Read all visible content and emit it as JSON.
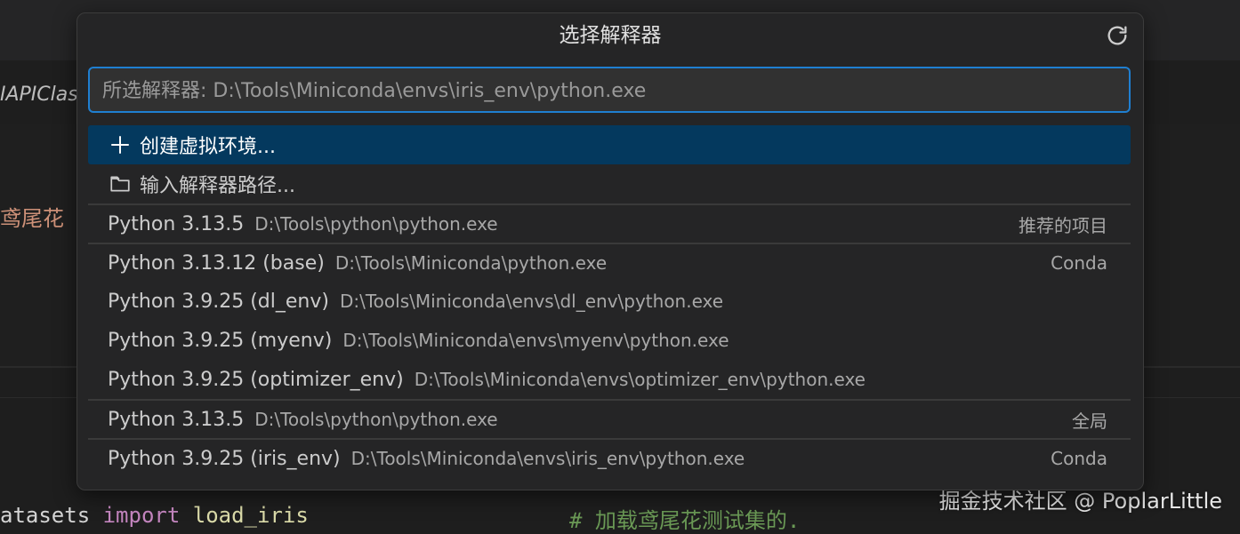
{
  "background": {
    "breadcrumb_text": "IAPIClas",
    "editor_text_fragment": "鸢尾花",
    "code_line": {
      "part1": "atasets ",
      "keyword": "import",
      "part2": " load_iris"
    },
    "code_comment": "# 加载鸢尾花测试集的.",
    "watermark": "掘金技术社区 @ PoplarLittle"
  },
  "picker": {
    "title": "选择解释器",
    "refresh_icon": "refresh-icon",
    "search": {
      "placeholder": "所选解释器: D:\\Tools\\Miniconda\\envs\\iris_env\\python.exe",
      "value": ""
    },
    "actions": [
      {
        "icon": "plus-icon",
        "label": "创建虚拟环境..."
      },
      {
        "icon": "folder-icon",
        "label": "输入解释器路径..."
      }
    ],
    "interpreters": [
      {
        "label": "Python 3.13.5",
        "path": "D:\\Tools\\python\\python.exe",
        "tag": "推荐的项目"
      },
      {
        "label": "Python 3.13.12 (base)",
        "path": "D:\\Tools\\Miniconda\\python.exe",
        "tag": "Conda"
      },
      {
        "label": "Python 3.9.25 (dl_env)",
        "path": "D:\\Tools\\Miniconda\\envs\\dl_env\\python.exe",
        "tag": ""
      },
      {
        "label": "Python 3.9.25 (myenv)",
        "path": "D:\\Tools\\Miniconda\\envs\\myenv\\python.exe",
        "tag": ""
      },
      {
        "label": "Python 3.9.25 (optimizer_env)",
        "path": "D:\\Tools\\Miniconda\\envs\\optimizer_env\\python.exe",
        "tag": ""
      },
      {
        "label": "Python 3.13.5",
        "path": "D:\\Tools\\python\\python.exe",
        "tag": "全局"
      },
      {
        "label": "Python 3.9.25 (iris_env)",
        "path": "D:\\Tools\\Miniconda\\envs\\iris_env\\python.exe",
        "tag": "Conda"
      }
    ]
  },
  "colors": {
    "selection": "#04395e",
    "focus_border": "#1f7fd1",
    "panel": "#252526"
  }
}
